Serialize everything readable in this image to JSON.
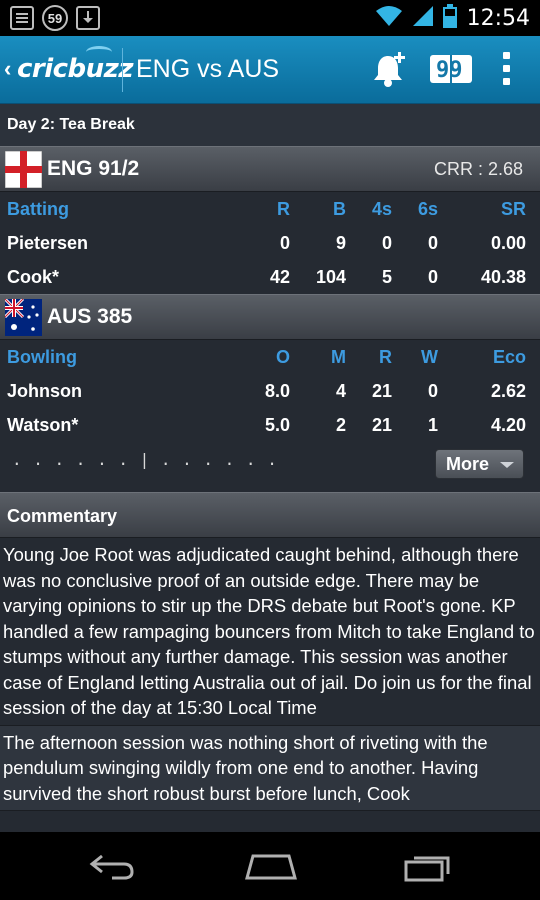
{
  "status_bar": {
    "notification_count": "59",
    "time": "12:54"
  },
  "action_bar": {
    "logo_text": "cricbuzz",
    "title": "ENG vs AUS",
    "scoreboard_icon_text": "99",
    "accent_color": "#0f7db0"
  },
  "match": {
    "day_status": "Day 2: Tea Break"
  },
  "batting_team": {
    "flag": "england-flag",
    "name_score": "ENG  91/2",
    "crr": "CRR : 2.68",
    "columns": [
      "Batting",
      "R",
      "B",
      "4s",
      "6s",
      "SR"
    ],
    "players": [
      {
        "name": "Pietersen",
        "r": "0",
        "b": "9",
        "fours": "0",
        "sixes": "0",
        "sr": "0.00"
      },
      {
        "name": "Cook*",
        "r": "42",
        "b": "104",
        "fours": "5",
        "sixes": "0",
        "sr": "40.38"
      }
    ]
  },
  "bowling_team": {
    "flag": "australia-flag",
    "name_score": "AUS  385",
    "columns": [
      "Bowling",
      "O",
      "M",
      "R",
      "W",
      "Eco"
    ],
    "players": [
      {
        "name": "Johnson",
        "o": "8.0",
        "m": "4",
        "r": "21",
        "w": "0",
        "eco": "2.62"
      },
      {
        "name": "Watson*",
        "o": "5.0",
        "m": "2",
        "r": "21",
        "w": "1",
        "eco": "4.20"
      }
    ]
  },
  "recent_balls": ". . . . . . | . . . . . .",
  "more_button": "More",
  "commentary": {
    "title": "Commentary",
    "items": [
      "Young Joe Root was adjudicated caught behind, although there was no conclusive proof of an outside edge. There may be varying opinions to stir up the DRS debate but Root's gone. KP handled a few rampaging bouncers from Mitch to take England to stumps without any further damage. This session was another case of England letting Australia out of jail. Do join us for the final session of the day at 15:30 Local Time",
      "The afternoon session was nothing short of riveting with the pendulum swinging wildly from one end to another. Having survived the short robust burst before lunch, Cook"
    ]
  }
}
